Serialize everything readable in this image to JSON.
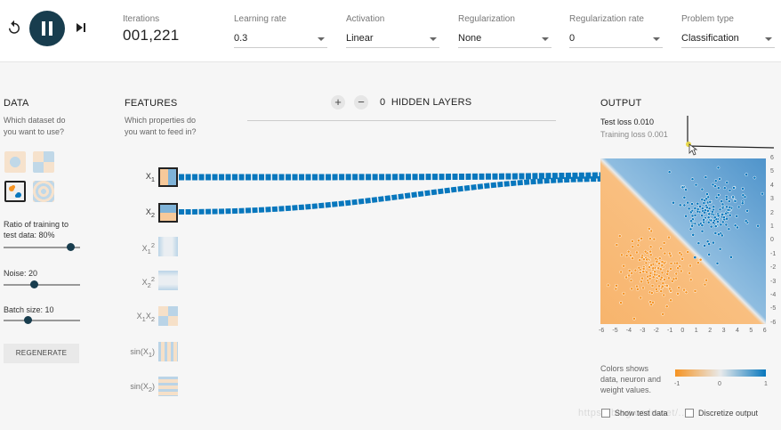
{
  "toolbar": {
    "iterations_label": "Iterations",
    "iterations_value": "001,221",
    "learning_rate": {
      "label": "Learning rate",
      "value": "0.3"
    },
    "activation": {
      "label": "Activation",
      "value": "Linear"
    },
    "regularization": {
      "label": "Regularization",
      "value": "None"
    },
    "regularization_rate": {
      "label": "Regularization rate",
      "value": "0"
    },
    "problem_type": {
      "label": "Problem type",
      "value": "Classification"
    }
  },
  "data_panel": {
    "title": "DATA",
    "subtitle": "Which dataset do\nyou want to use?",
    "datasets": [
      "circle",
      "xor",
      "gauss",
      "spiral"
    ],
    "selected_dataset": "gauss",
    "ratio_label": "Ratio of training to\ntest data:  80%",
    "ratio_value": 0.8,
    "noise_label": "Noise:  20",
    "noise_value": 20,
    "batch_label": "Batch size:  10",
    "batch_value": 10,
    "regenerate_label": "REGENERATE"
  },
  "features_panel": {
    "title": "FEATURES",
    "subtitle": "Which properties do\nyou want to feed in?",
    "features": [
      {
        "label": "X1",
        "active": true
      },
      {
        "label": "X2",
        "active": true
      },
      {
        "label": "X1²",
        "active": false
      },
      {
        "label": "X2²",
        "active": false
      },
      {
        "label": "X1X2",
        "active": false
      },
      {
        "label": "sin(X1)",
        "active": false
      },
      {
        "label": "sin(X2)",
        "active": false
      }
    ]
  },
  "network": {
    "add_layer_symbol": "+",
    "remove_layer_symbol": "−",
    "layers_count": "0",
    "layers_label": "HIDDEN LAYERS"
  },
  "output": {
    "title": "OUTPUT",
    "test_loss": "Test loss 0.010",
    "training_loss": "Training loss 0.001",
    "x_ticks": [
      "-6",
      "-5",
      "-4",
      "-3",
      "-2",
      "-1",
      "0",
      "1",
      "2",
      "3",
      "4",
      "5",
      "6"
    ],
    "y_ticks": [
      "6",
      "5",
      "4",
      "3",
      "2",
      "1",
      "0",
      "-1",
      "-2",
      "-3",
      "-4",
      "-5",
      "-6"
    ],
    "legend_text": "Colors shows\ndata, neuron and\nweight values.",
    "colorbar_ticks": [
      "-1",
      "0",
      "1"
    ],
    "show_test_data_label": "Show test data",
    "discretize_label": "Discretize output",
    "show_test_data": false,
    "discretize": false
  },
  "colors": {
    "positive": "#0877bd",
    "negative": "#f59322",
    "neutral": "#e8eaeb",
    "play_button": "#183d4e"
  },
  "watermark": "https://blog.csdn.net/..."
}
